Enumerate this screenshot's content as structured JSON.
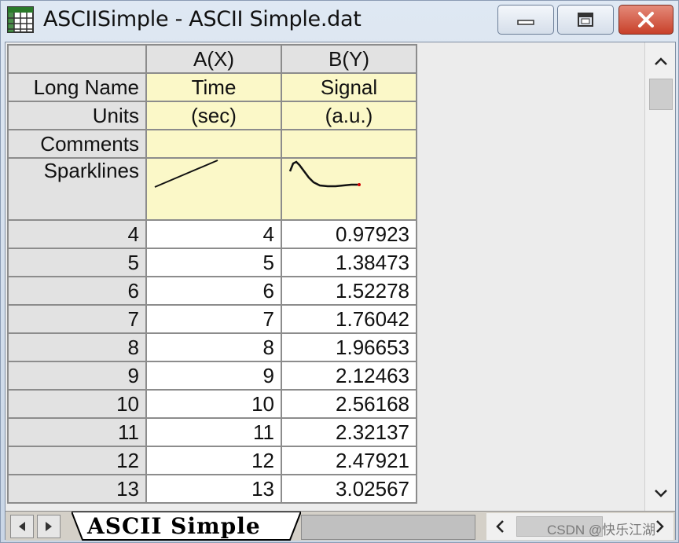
{
  "window": {
    "title": "ASCIISimple - ASCII Simple.dat"
  },
  "columns": {
    "a": {
      "header": "A(X)",
      "long_name": "Time",
      "units": "(sec)",
      "comments": ""
    },
    "b": {
      "header": "B(Y)",
      "long_name": "Signal",
      "units": "(a.u.)",
      "comments": ""
    }
  },
  "row_labels": {
    "long_name": "Long Name",
    "units": "Units",
    "comments": "Comments",
    "sparklines": "Sparklines"
  },
  "rows": [
    {
      "index": "4",
      "a": "4",
      "b": "0.97923"
    },
    {
      "index": "5",
      "a": "5",
      "b": "1.38473"
    },
    {
      "index": "6",
      "a": "6",
      "b": "1.52278"
    },
    {
      "index": "7",
      "a": "7",
      "b": "1.76042"
    },
    {
      "index": "8",
      "a": "8",
      "b": "1.96653"
    },
    {
      "index": "9",
      "a": "9",
      "b": "2.12463"
    },
    {
      "index": "10",
      "a": "10",
      "b": "2.56168"
    },
    {
      "index": "11",
      "a": "11",
      "b": "2.32137"
    },
    {
      "index": "12",
      "a": "12",
      "b": "2.47921"
    },
    {
      "index": "13",
      "a": "13",
      "b": "3.02567"
    }
  ],
  "sheet_tab": {
    "label": "ASCII Simple"
  },
  "watermark": "CSDN @快乐江湖",
  "icons": {
    "app": "worksheet-grid-icon",
    "minimize": "minimize-icon",
    "maximize": "maximize-icon",
    "close": "close-icon"
  },
  "colors": {
    "metadata_bg": "#fbf8c8",
    "close_button": "#c8402a",
    "sparkline_marker": "#d00000"
  }
}
